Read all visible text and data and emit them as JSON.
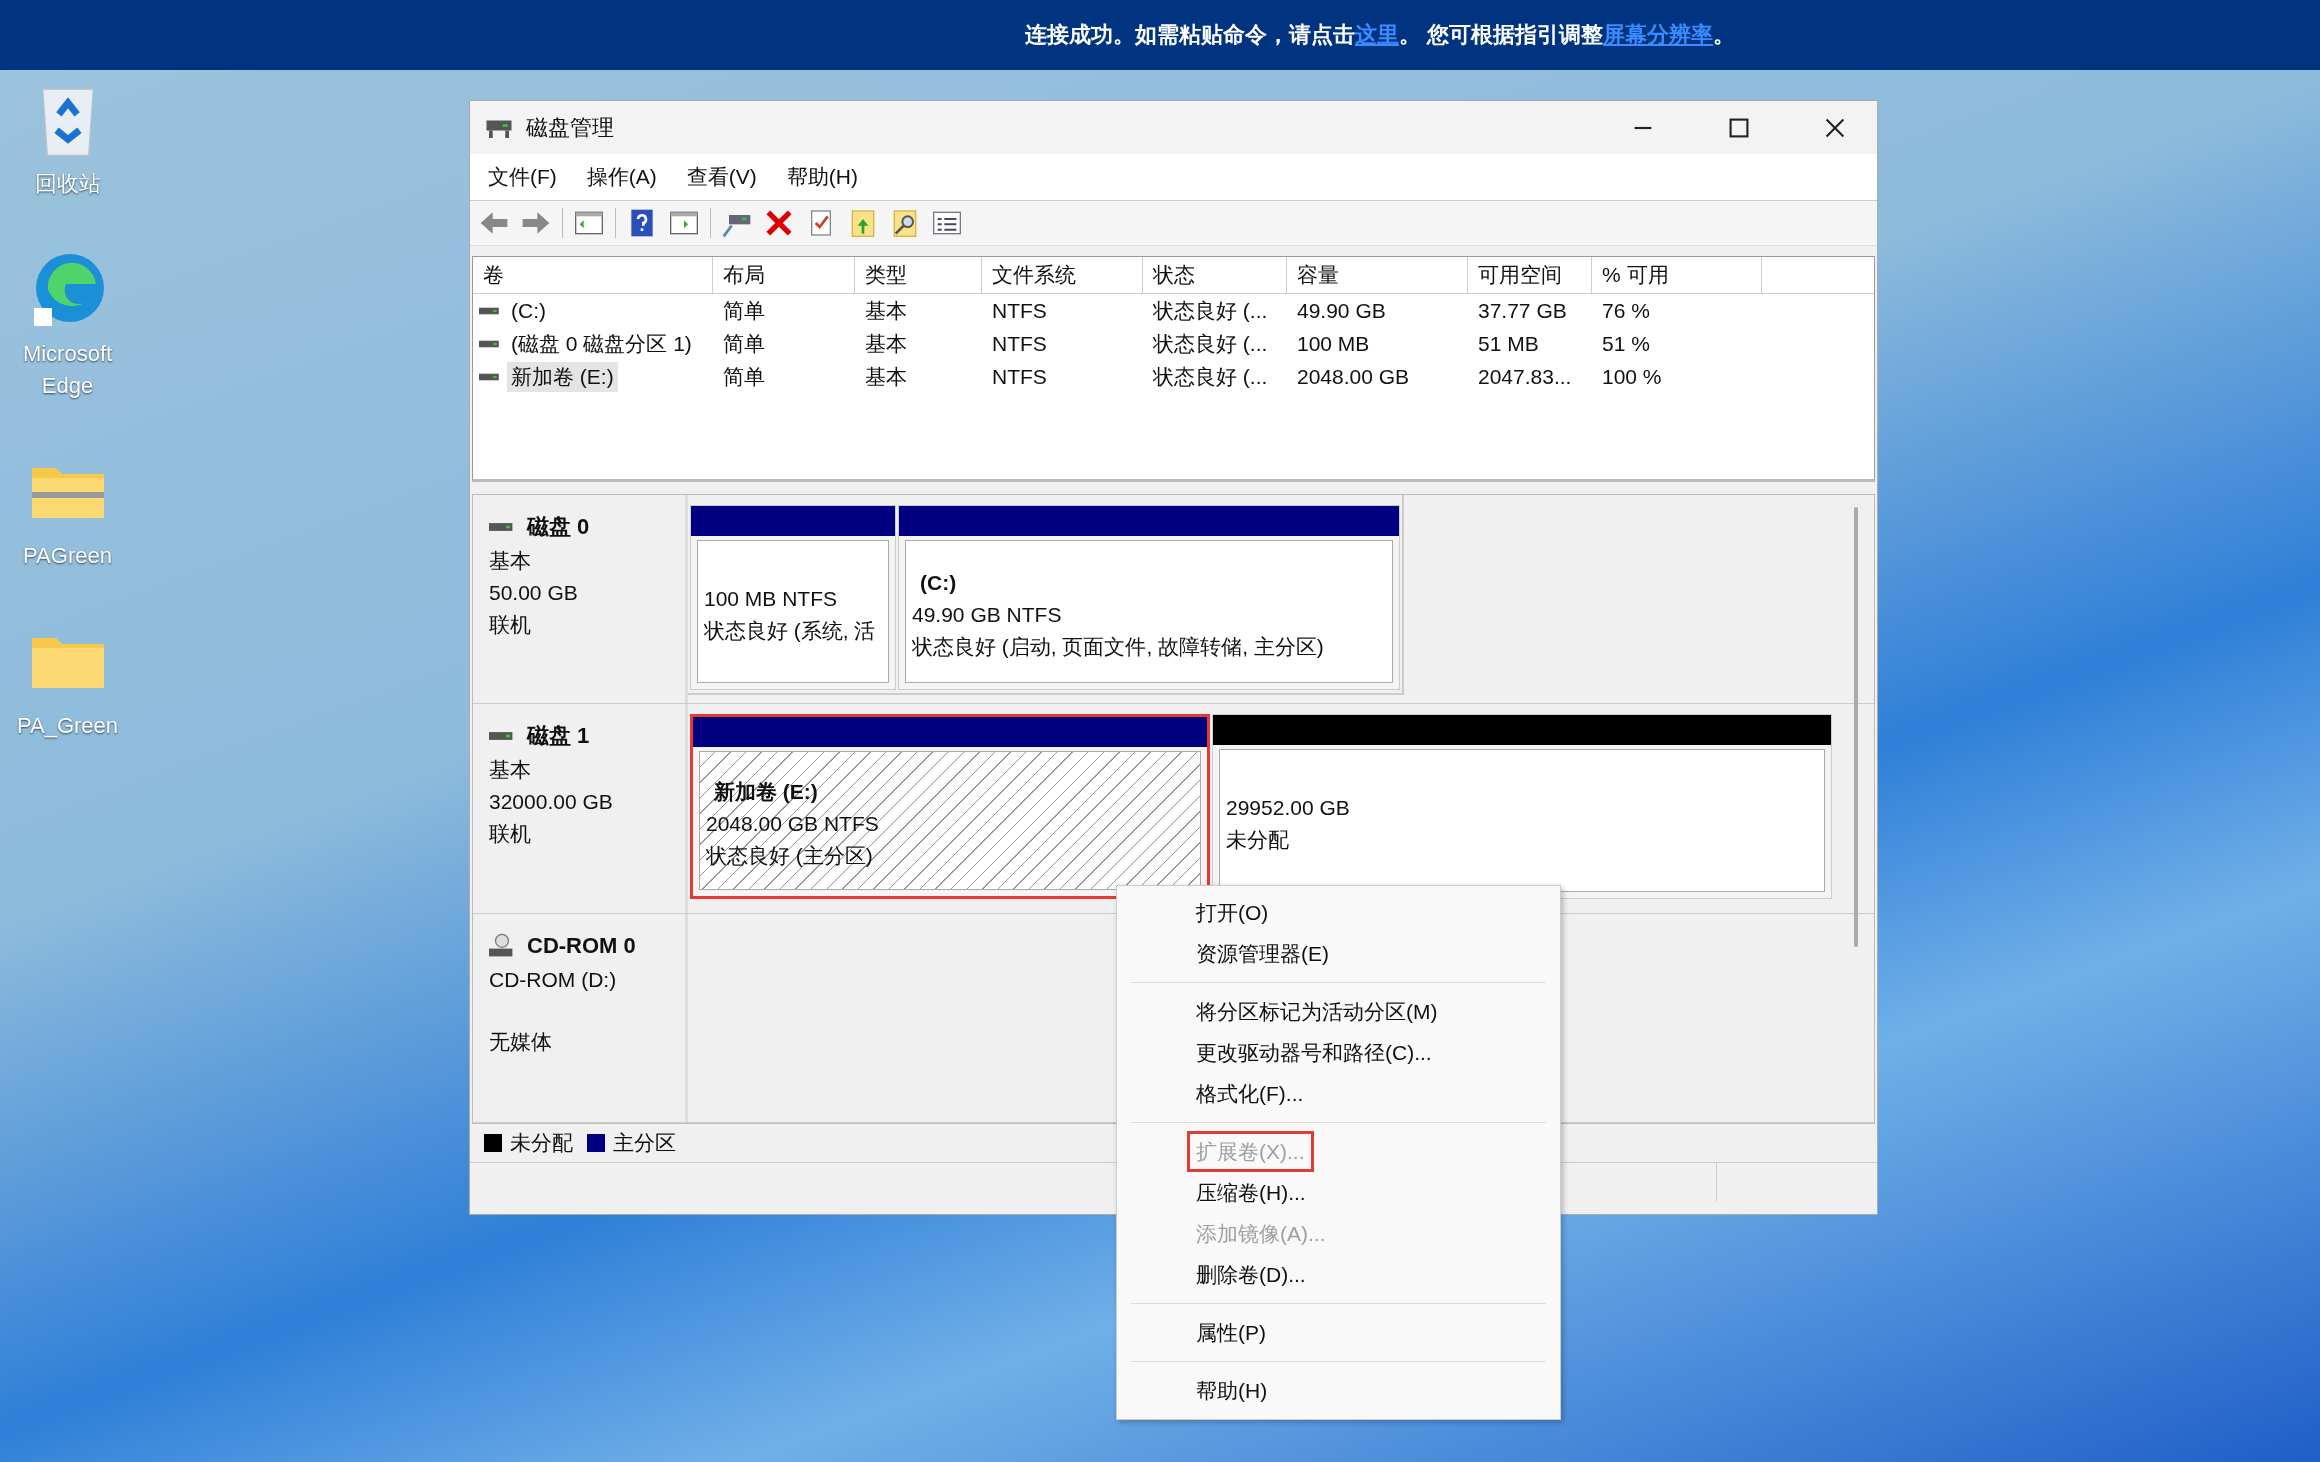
{
  "banner": {
    "parts": [
      {
        "kind": "text",
        "text": "连接成功。如需粘贴命令，请点击"
      },
      {
        "kind": "link",
        "text": "这里"
      },
      {
        "kind": "text",
        "text": "。 您可根据指引调整"
      },
      {
        "kind": "link",
        "text": "屏幕分辨率"
      },
      {
        "kind": "text",
        "text": "。"
      }
    ]
  },
  "desktop_icons": [
    {
      "kind": "recycle",
      "label": "回收站"
    },
    {
      "kind": "edge",
      "label": "Microsoft Edge"
    },
    {
      "kind": "zip",
      "label": "PAGreen"
    },
    {
      "kind": "folder",
      "label": "PA_Green"
    }
  ],
  "window": {
    "title": "磁盘管理"
  },
  "menu": [
    "文件(F)",
    "操作(A)",
    "查看(V)",
    "帮助(H)"
  ],
  "volumes": {
    "columns": [
      "卷",
      "布局",
      "类型",
      "文件系统",
      "状态",
      "容量",
      "可用空间",
      "% 可用"
    ],
    "rows": [
      {
        "selected": false,
        "cells": [
          "(C:)",
          "简单",
          "基本",
          "NTFS",
          "状态良好 (...",
          "49.90 GB",
          "37.77 GB",
          "76 %"
        ]
      },
      {
        "selected": false,
        "cells": [
          "(磁盘 0 磁盘分区 1)",
          "简单",
          "基本",
          "NTFS",
          "状态良好 (...",
          "100 MB",
          "51 MB",
          "51 %"
        ]
      },
      {
        "selected": true,
        "cells": [
          "新加卷 (E:)",
          "简单",
          "基本",
          "NTFS",
          "状态良好 (...",
          "2048.00 GB",
          "2047.83...",
          "100 %"
        ]
      }
    ]
  },
  "disks": [
    {
      "kind": "disk",
      "name": "磁盘 0",
      "type": "基本",
      "size": "50.00 GB",
      "status": "联机",
      "partitions": [
        {
          "kind": "primary",
          "selected": false,
          "lines": [
            "100 MB NTFS",
            "状态良好 (系统, 活"
          ]
        },
        {
          "kind": "primary",
          "selected": false,
          "title": "(C:)",
          "lines": [
            "49.90 GB NTFS",
            "状态良好 (启动, 页面文件, 故障转储, 主分区)"
          ]
        }
      ]
    },
    {
      "kind": "disk",
      "name": "磁盘 1",
      "type": "基本",
      "size": "32000.00 GB",
      "status": "联机",
      "partitions": [
        {
          "kind": "primary",
          "selected": true,
          "title": "新加卷  (E:)",
          "lines": [
            "2048.00 GB NTFS",
            "状态良好 (主分区)"
          ]
        },
        {
          "kind": "unallocated",
          "selected": false,
          "lines": [
            "29952.00 GB",
            "未分配"
          ]
        }
      ]
    },
    {
      "kind": "cdrom",
      "name": "CD-ROM 0",
      "drive": "CD-ROM (D:)",
      "media": "无媒体"
    }
  ],
  "legend": [
    {
      "label": "未分配",
      "color": "#000000"
    },
    {
      "label": "主分区",
      "color": "#000080"
    }
  ],
  "context_menu": {
    "groups": [
      [
        {
          "label": "打开(O)",
          "disabled": false,
          "outlined": false
        },
        {
          "label": "资源管理器(E)",
          "disabled": false,
          "outlined": false
        }
      ],
      [
        {
          "label": "将分区标记为活动分区(M)",
          "disabled": false,
          "outlined": false
        },
        {
          "label": "更改驱动器号和路径(C)...",
          "disabled": false,
          "outlined": false
        },
        {
          "label": "格式化(F)...",
          "disabled": false,
          "outlined": false
        }
      ],
      [
        {
          "label": "扩展卷(X)...",
          "disabled": true,
          "outlined": true
        },
        {
          "label": "压缩卷(H)...",
          "disabled": false,
          "outlined": false
        },
        {
          "label": "添加镜像(A)...",
          "disabled": true,
          "outlined": false
        },
        {
          "label": "删除卷(D)...",
          "disabled": false,
          "outlined": false
        }
      ],
      [
        {
          "label": "属性(P)",
          "disabled": false,
          "outlined": false
        }
      ],
      [
        {
          "label": "帮助(H)",
          "disabled": false,
          "outlined": false
        }
      ]
    ]
  }
}
